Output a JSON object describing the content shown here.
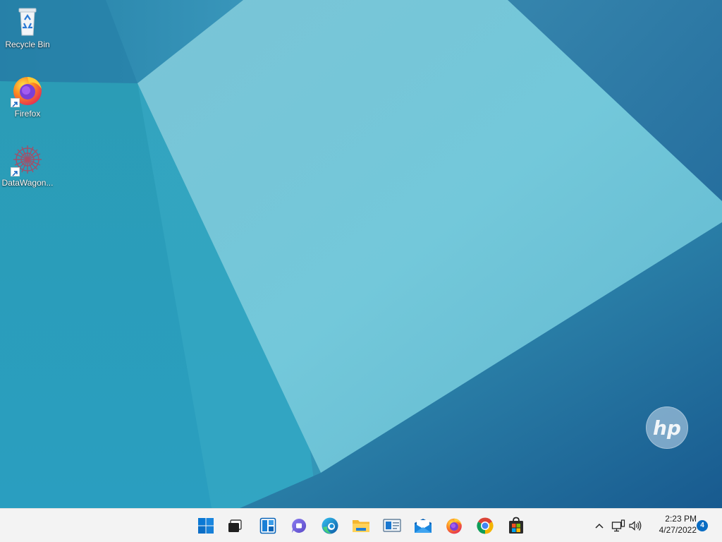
{
  "desktop": {
    "icons": [
      {
        "label": "Recycle Bin",
        "icon": "recycle-bin-icon"
      },
      {
        "label": "Firefox",
        "icon": "firefox-icon",
        "shortcut": true
      },
      {
        "label": "DataWagon...",
        "icon": "datawagon-icon",
        "shortcut": true
      }
    ],
    "wallpaper": {
      "brand_logo": "hp",
      "colors": [
        "#2a9bb3",
        "#78cbd9",
        "#1a5e93"
      ]
    }
  },
  "taskbar": {
    "apps": [
      {
        "name": "Start",
        "icon": "windows-start-icon"
      },
      {
        "name": "Task View",
        "icon": "task-view-icon"
      },
      {
        "name": "Widgets",
        "icon": "widgets-icon"
      },
      {
        "name": "Chat",
        "icon": "teams-chat-icon"
      },
      {
        "name": "Microsoft Edge",
        "icon": "edge-icon"
      },
      {
        "name": "File Explorer",
        "icon": "file-explorer-icon"
      },
      {
        "name": "Control Panel",
        "icon": "control-panel-icon"
      },
      {
        "name": "Mail",
        "icon": "mail-icon"
      },
      {
        "name": "Firefox",
        "icon": "firefox-icon"
      },
      {
        "name": "Google Chrome",
        "icon": "chrome-icon"
      },
      {
        "name": "Microsoft Store",
        "icon": "store-icon"
      }
    ],
    "tray": {
      "icons": [
        "chevron-up-icon",
        "network-icon",
        "volume-icon"
      ],
      "time": "2:23 PM",
      "date": "4/27/2022",
      "notification_count": "4"
    }
  }
}
